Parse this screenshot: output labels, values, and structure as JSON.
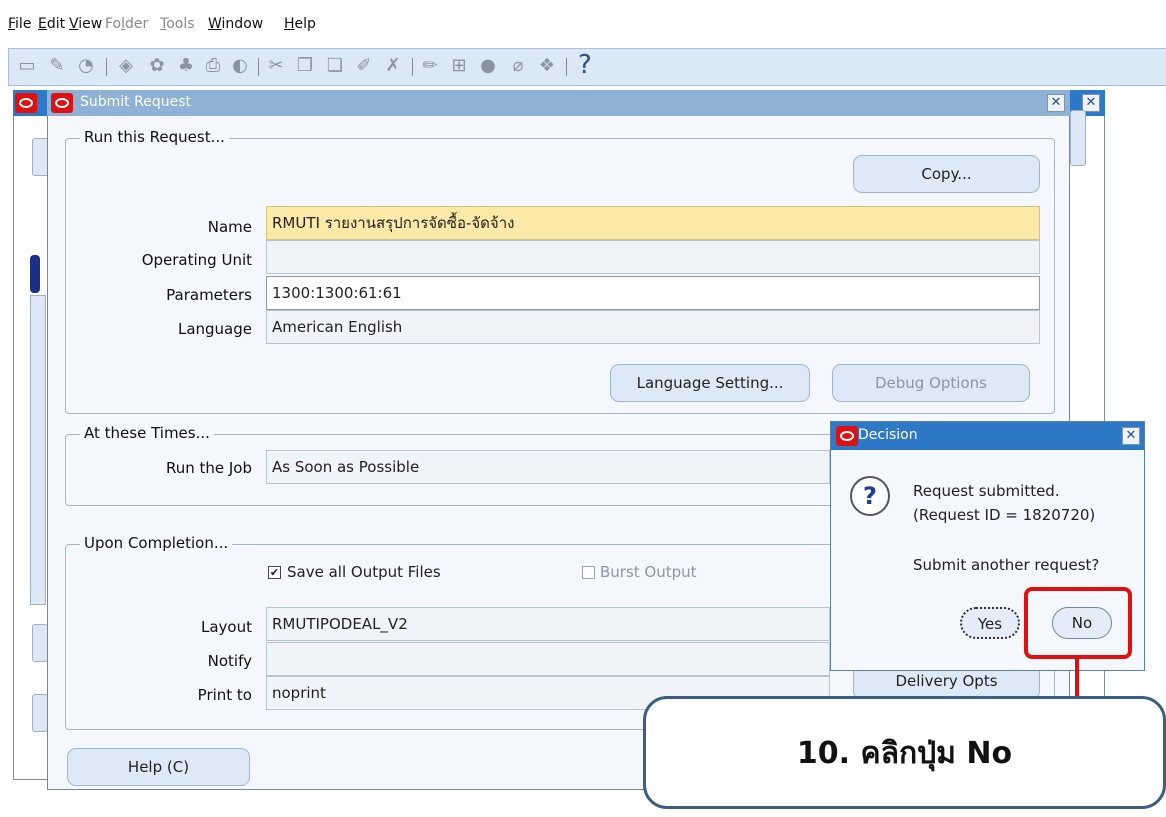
{
  "menu": {
    "items": [
      {
        "label": "File",
        "mnemonic": "F",
        "rest": "ile",
        "enabled": true
      },
      {
        "label": "Edit",
        "mnemonic": "E",
        "rest": "dit",
        "enabled": true
      },
      {
        "label": "View",
        "mnemonic": "V",
        "rest": "iew",
        "enabled": true
      },
      {
        "label": "Folder",
        "pre": "Fo",
        "mnemonic": "l",
        "rest": "der",
        "enabled": false
      },
      {
        "label": "Tools",
        "mnemonic": "T",
        "rest": "ools",
        "enabled": false
      },
      {
        "label": "Window",
        "mnemonic": "W",
        "rest": "indow",
        "enabled": true
      },
      {
        "label": "Help",
        "mnemonic": "H",
        "rest": "elp",
        "enabled": true
      }
    ]
  },
  "toolbar": {
    "icons": [
      "new-icon",
      "find-icon",
      "navigator-icon",
      "save-icon",
      "next-step-icon",
      "switch-responsibility-icon",
      "print-icon",
      "close-form-icon",
      "cut-icon",
      "copy-icon",
      "paste-icon",
      "clear-record-icon",
      "delete-icon",
      "edit-field-icon",
      "zoom-icon",
      "translations-icon",
      "attachments-icon",
      "folder-tools-icon"
    ],
    "help_glyph": "?"
  },
  "submit_request": {
    "title": "Submit Request",
    "run_section": {
      "label": "Run this Request...",
      "copy_button": "Copy...",
      "name_label": "Name",
      "name_value": "RMUTI รายงานสรุปการจัดซื้อ-จัดจ้าง",
      "operating_unit_label": "Operating Unit",
      "operating_unit_value": "",
      "parameters_label": "Parameters",
      "parameters_value": "1300:1300:61:61",
      "language_label": "Language",
      "language_value": "American English",
      "language_setting_button": "Language Setting...",
      "debug_options_button": "Debug Options"
    },
    "times_section": {
      "label": "At these Times...",
      "run_job_label": "Run the Job",
      "run_job_value": "As Soon as Possible"
    },
    "completion_section": {
      "label": "Upon Completion...",
      "save_output_label": "Save all Output Files",
      "save_output_checked": true,
      "burst_output_label": "Burst Output",
      "burst_output_checked": false,
      "layout_label": "Layout",
      "layout_value": "RMUTIPODEAL_V2",
      "notify_label": "Notify",
      "notify_value": "",
      "print_to_label": "Print to",
      "print_to_value": "noprint",
      "delivery_opts_button": "Delivery Opts"
    },
    "help_button": "Help (C)"
  },
  "decision_dialog": {
    "title": "Decision",
    "message_line1": "Request submitted.",
    "message_line2": "(Request ID = 1820720)",
    "question": "Submit another request?",
    "yes_button": "Yes",
    "no_button": "No"
  },
  "annotation": {
    "callout_text": "10. คลิกปุ่ม No",
    "highlight_color": "#e01010"
  }
}
